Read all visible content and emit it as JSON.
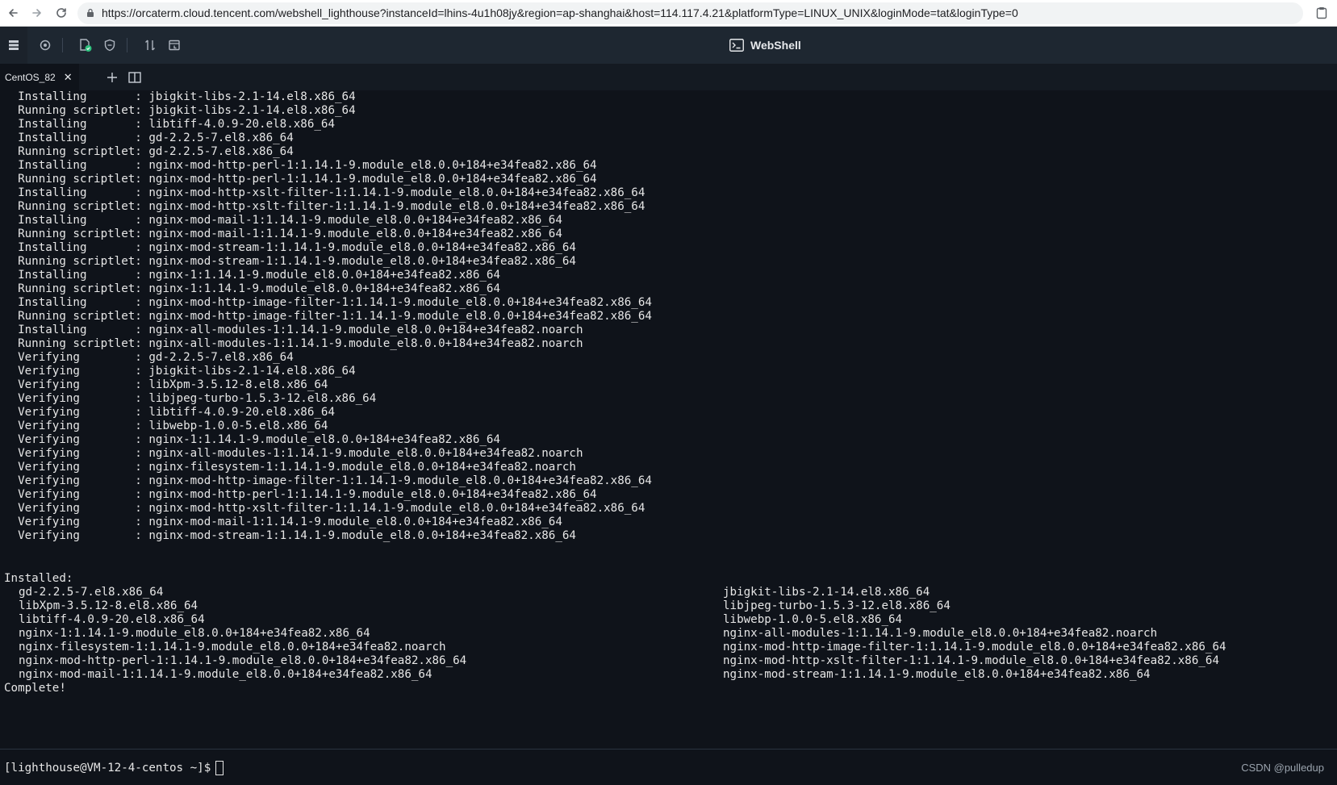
{
  "browser": {
    "url": "https://orcaterm.cloud.tencent.com/webshell_lighthouse?instanceId=lhins-4u1h08jy&region=ap-shanghai&host=114.117.4.21&platformType=LINUX_UNIX&loginMode=tat&loginType=0",
    "icons": [
      "back-arrow-icon",
      "forward-arrow-icon",
      "reload-icon",
      "lock-icon",
      "clipboard-icon"
    ]
  },
  "app": {
    "title": "WebShell",
    "toolbar_icons": [
      "layout-icon",
      "settings-icon",
      "file-check-icon",
      "shield-icon",
      "transfer-icon",
      "history-icon"
    ]
  },
  "tabs": [
    {
      "label": "CentOS_82",
      "close": "✕"
    }
  ],
  "terminal": {
    "lines": [
      "  Installing       : jbigkit-libs-2.1-14.el8.x86_64",
      "  Running scriptlet: jbigkit-libs-2.1-14.el8.x86_64",
      "  Installing       : libtiff-4.0.9-20.el8.x86_64",
      "  Installing       : gd-2.2.5-7.el8.x86_64",
      "  Running scriptlet: gd-2.2.5-7.el8.x86_64",
      "  Installing       : nginx-mod-http-perl-1:1.14.1-9.module_el8.0.0+184+e34fea82.x86_64",
      "  Running scriptlet: nginx-mod-http-perl-1:1.14.1-9.module_el8.0.0+184+e34fea82.x86_64",
      "  Installing       : nginx-mod-http-xslt-filter-1:1.14.1-9.module_el8.0.0+184+e34fea82.x86_64",
      "  Running scriptlet: nginx-mod-http-xslt-filter-1:1.14.1-9.module_el8.0.0+184+e34fea82.x86_64",
      "  Installing       : nginx-mod-mail-1:1.14.1-9.module_el8.0.0+184+e34fea82.x86_64",
      "  Running scriptlet: nginx-mod-mail-1:1.14.1-9.module_el8.0.0+184+e34fea82.x86_64",
      "  Installing       : nginx-mod-stream-1:1.14.1-9.module_el8.0.0+184+e34fea82.x86_64",
      "  Running scriptlet: nginx-mod-stream-1:1.14.1-9.module_el8.0.0+184+e34fea82.x86_64",
      "  Installing       : nginx-1:1.14.1-9.module_el8.0.0+184+e34fea82.x86_64",
      "  Running scriptlet: nginx-1:1.14.1-9.module_el8.0.0+184+e34fea82.x86_64",
      "  Installing       : nginx-mod-http-image-filter-1:1.14.1-9.module_el8.0.0+184+e34fea82.x86_64",
      "  Running scriptlet: nginx-mod-http-image-filter-1:1.14.1-9.module_el8.0.0+184+e34fea82.x86_64",
      "  Installing       : nginx-all-modules-1:1.14.1-9.module_el8.0.0+184+e34fea82.noarch",
      "  Running scriptlet: nginx-all-modules-1:1.14.1-9.module_el8.0.0+184+e34fea82.noarch",
      "  Verifying        : gd-2.2.5-7.el8.x86_64",
      "  Verifying        : jbigkit-libs-2.1-14.el8.x86_64",
      "  Verifying        : libXpm-3.5.12-8.el8.x86_64",
      "  Verifying        : libjpeg-turbo-1.5.3-12.el8.x86_64",
      "  Verifying        : libtiff-4.0.9-20.el8.x86_64",
      "  Verifying        : libwebp-1.0.0-5.el8.x86_64",
      "  Verifying        : nginx-1:1.14.1-9.module_el8.0.0+184+e34fea82.x86_64",
      "  Verifying        : nginx-all-modules-1:1.14.1-9.module_el8.0.0+184+e34fea82.noarch",
      "  Verifying        : nginx-filesystem-1:1.14.1-9.module_el8.0.0+184+e34fea82.noarch",
      "  Verifying        : nginx-mod-http-image-filter-1:1.14.1-9.module_el8.0.0+184+e34fea82.x86_64",
      "  Verifying        : nginx-mod-http-perl-1:1.14.1-9.module_el8.0.0+184+e34fea82.x86_64",
      "  Verifying        : nginx-mod-http-xslt-filter-1:1.14.1-9.module_el8.0.0+184+e34fea82.x86_64",
      "  Verifying        : nginx-mod-mail-1:1.14.1-9.module_el8.0.0+184+e34fea82.x86_64",
      "  Verifying        : nginx-mod-stream-1:1.14.1-9.module_el8.0.0+184+e34fea82.x86_64"
    ],
    "installed_header": "Installed:",
    "installed": [
      [
        "gd-2.2.5-7.el8.x86_64",
        "jbigkit-libs-2.1-14.el8.x86_64"
      ],
      [
        "libXpm-3.5.12-8.el8.x86_64",
        "libjpeg-turbo-1.5.3-12.el8.x86_64"
      ],
      [
        "libtiff-4.0.9-20.el8.x86_64",
        "libwebp-1.0.0-5.el8.x86_64"
      ],
      [
        "nginx-1:1.14.1-9.module_el8.0.0+184+e34fea82.x86_64",
        "nginx-all-modules-1:1.14.1-9.module_el8.0.0+184+e34fea82.noarch"
      ],
      [
        "nginx-filesystem-1:1.14.1-9.module_el8.0.0+184+e34fea82.noarch",
        "nginx-mod-http-image-filter-1:1.14.1-9.module_el8.0.0+184+e34fea82.x86_64"
      ],
      [
        "nginx-mod-http-perl-1:1.14.1-9.module_el8.0.0+184+e34fea82.x86_64",
        "nginx-mod-http-xslt-filter-1:1.14.1-9.module_el8.0.0+184+e34fea82.x86_64"
      ],
      [
        "nginx-mod-mail-1:1.14.1-9.module_el8.0.0+184+e34fea82.x86_64",
        "nginx-mod-stream-1:1.14.1-9.module_el8.0.0+184+e34fea82.x86_64"
      ]
    ],
    "complete": "Complete!",
    "prompt": "[lighthouse@VM-12-4-centos ~]$"
  },
  "watermark": "CSDN @pulledup",
  "colors": {
    "terminal_bg": "#0f131a",
    "toolbar_bg": "#1e2731",
    "tabs_bg": "#141a22",
    "text": "#e6e6e6",
    "accent_green": "#2ec27e"
  }
}
